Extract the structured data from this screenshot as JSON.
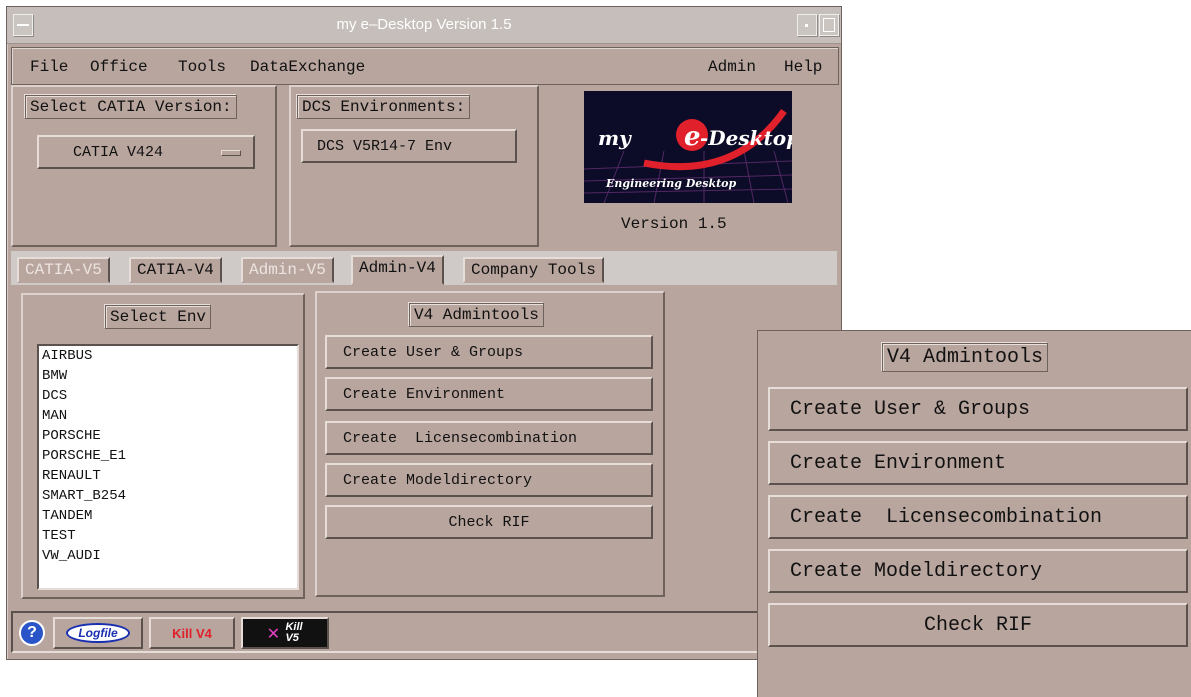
{
  "window": {
    "title": "my e–Desktop Version 1.5"
  },
  "menubar": {
    "left": [
      "File",
      "Office",
      "Tools",
      "DataExchange"
    ],
    "right": [
      "Admin",
      "Help"
    ]
  },
  "catia_version": {
    "label": "Select CATIA Version:",
    "selected": "CATIA V424"
  },
  "dcs": {
    "label": "DCS Environments:",
    "button": "DCS V5R14-7 Env"
  },
  "logo": {
    "brand_prefix": "my",
    "brand_e": "e",
    "brand_rest": "-Desktop",
    "tagline": "Engineering Desktop",
    "version": "Version 1.5"
  },
  "tabs": [
    {
      "label": "CATIA-V5",
      "state": "disabled"
    },
    {
      "label": "CATIA-V4",
      "state": "normal"
    },
    {
      "label": "Admin-V5",
      "state": "disabled"
    },
    {
      "label": "Admin-V4",
      "state": "active"
    },
    {
      "label": "Company Tools",
      "state": "normal"
    }
  ],
  "select_env": {
    "label": "Select Env",
    "items": [
      "AIRBUS",
      "BMW",
      "DCS",
      "MAN",
      "PORSCHE",
      "PORSCHE_E1",
      "RENAULT",
      "SMART_B254",
      "TANDEM",
      "TEST",
      "VW_AUDI"
    ]
  },
  "admintools": {
    "label": "V4 Admintools",
    "buttons": [
      "Create User & Groups",
      "Create Environment",
      "Create  Licensecombination",
      "Create Modeldirectory",
      "Check RIF"
    ]
  },
  "statusbar": {
    "help": "?",
    "logfile": "Logfile",
    "kill_v4": "Kill V4",
    "kill_v5_line1": "Kill",
    "kill_v5_line2": "V5"
  },
  "colors": {
    "panel": "#b8a59e",
    "titlebar": "#c5beba",
    "logo_red": "#e0202a",
    "logo_bg": "#101030",
    "help_blue": "#2a55c8"
  }
}
